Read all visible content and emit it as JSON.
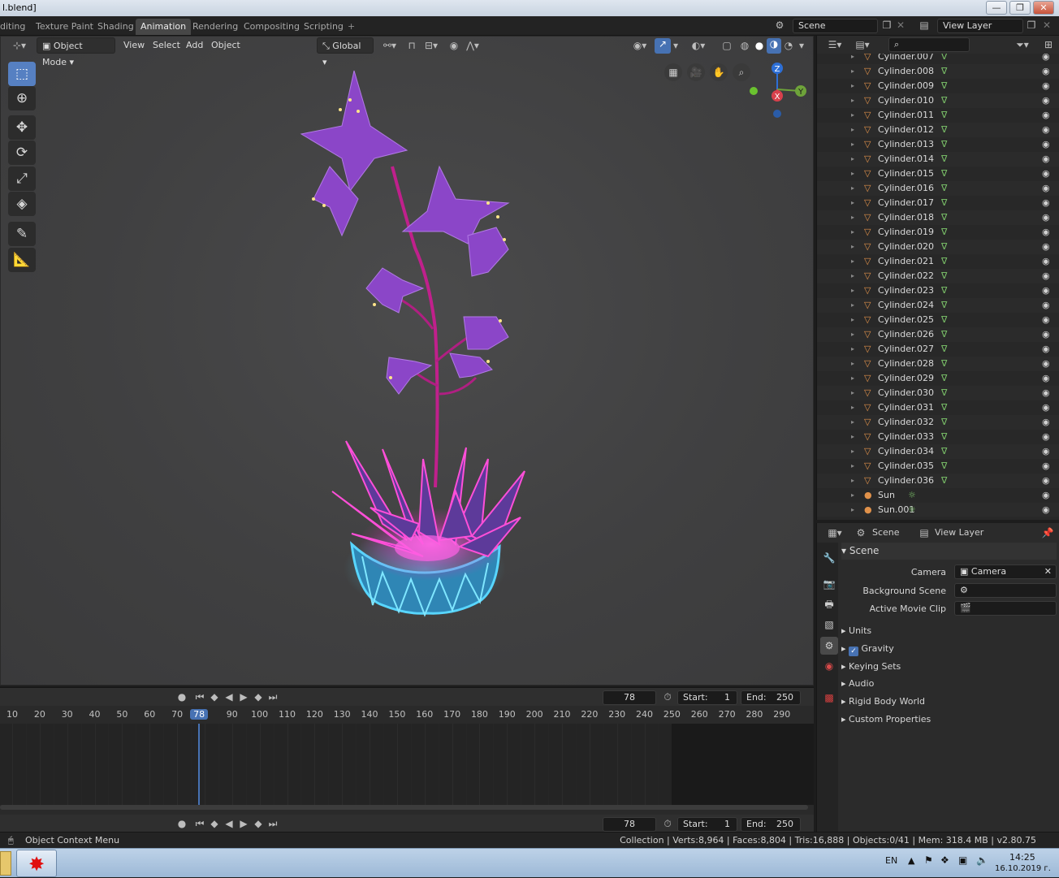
{
  "window": {
    "title": "l.blend]",
    "minimize": "—",
    "maximize": "❐",
    "close": "✕"
  },
  "workspaces": [
    "diting",
    "Texture Paint",
    "Shading",
    "Animation",
    "Rendering",
    "Compositing",
    "Scripting"
  ],
  "workspace_active": "Animation",
  "workspace_add": "+",
  "scene_field": "Scene",
  "view_layer_field": "View Layer",
  "viewport_header": {
    "mode": "Object Mode",
    "menus": [
      "View",
      "Select",
      "Add",
      "Object"
    ],
    "transform_orientation": "Global"
  },
  "gizmo": {
    "z": "Z",
    "y": "Y",
    "x": "X"
  },
  "outliner": {
    "search_placeholder": "",
    "rows": [
      {
        "name": "Cylinder.007",
        "type": "mesh"
      },
      {
        "name": "Cylinder.008",
        "type": "mesh"
      },
      {
        "name": "Cylinder.009",
        "type": "mesh"
      },
      {
        "name": "Cylinder.010",
        "type": "mesh"
      },
      {
        "name": "Cylinder.011",
        "type": "mesh"
      },
      {
        "name": "Cylinder.012",
        "type": "mesh"
      },
      {
        "name": "Cylinder.013",
        "type": "mesh"
      },
      {
        "name": "Cylinder.014",
        "type": "mesh"
      },
      {
        "name": "Cylinder.015",
        "type": "mesh"
      },
      {
        "name": "Cylinder.016",
        "type": "mesh"
      },
      {
        "name": "Cylinder.017",
        "type": "mesh"
      },
      {
        "name": "Cylinder.018",
        "type": "mesh"
      },
      {
        "name": "Cylinder.019",
        "type": "mesh"
      },
      {
        "name": "Cylinder.020",
        "type": "mesh"
      },
      {
        "name": "Cylinder.021",
        "type": "mesh"
      },
      {
        "name": "Cylinder.022",
        "type": "mesh"
      },
      {
        "name": "Cylinder.023",
        "type": "mesh"
      },
      {
        "name": "Cylinder.024",
        "type": "mesh"
      },
      {
        "name": "Cylinder.025",
        "type": "mesh"
      },
      {
        "name": "Cylinder.026",
        "type": "mesh"
      },
      {
        "name": "Cylinder.027",
        "type": "mesh"
      },
      {
        "name": "Cylinder.028",
        "type": "mesh"
      },
      {
        "name": "Cylinder.029",
        "type": "mesh"
      },
      {
        "name": "Cylinder.030",
        "type": "mesh"
      },
      {
        "name": "Cylinder.031",
        "type": "mesh"
      },
      {
        "name": "Cylinder.032",
        "type": "mesh"
      },
      {
        "name": "Cylinder.033",
        "type": "mesh"
      },
      {
        "name": "Cylinder.034",
        "type": "mesh"
      },
      {
        "name": "Cylinder.035",
        "type": "mesh"
      },
      {
        "name": "Cylinder.036",
        "type": "mesh"
      },
      {
        "name": "Sun",
        "type": "light"
      },
      {
        "name": "Sun.001",
        "type": "light"
      }
    ]
  },
  "properties": {
    "header_scene": "Scene",
    "header_view_layer": "View Layer",
    "panel_title": "Scene",
    "camera_label": "Camera",
    "camera_value": "Camera",
    "background_scene_label": "Background Scene",
    "active_movie_clip_label": "Active Movie Clip",
    "subpanels": [
      "Units",
      "Gravity",
      "Keying Sets",
      "Audio",
      "Rigid Body World",
      "Custom Properties"
    ],
    "gravity_checked": true
  },
  "timeline": {
    "current_frame": "78",
    "start_label": "Start:",
    "start_value": "1",
    "end_label": "End:",
    "end_value": "250",
    "ruler": [
      "10",
      "20",
      "30",
      "40",
      "50",
      "60",
      "70",
      "78",
      "90",
      "100",
      "110",
      "120",
      "130",
      "140",
      "150",
      "160",
      "170",
      "180",
      "190",
      "200",
      "210",
      "220",
      "230",
      "240",
      "250",
      "260",
      "270",
      "280",
      "290"
    ],
    "playhead": 78,
    "frame_end": 250
  },
  "statusbar": {
    "left": "Object Context Menu",
    "right": "Collection | Verts:8,964 | Faces:8,804 | Tris:16,888 | Objects:0/41 | Mem: 318.4 MB | v2.80.75"
  },
  "taskbar": {
    "lang": "EN",
    "time": "14:25",
    "date": "16.10.2019 г."
  },
  "colors": {
    "accent": "#4772b3",
    "mesh_icon": "#e0914a",
    "data_icon": "#7ec86b",
    "petal": "#8a45c8",
    "crystal_pink": "#ff3fd2",
    "crystal_blue": "#3fc8ff"
  }
}
